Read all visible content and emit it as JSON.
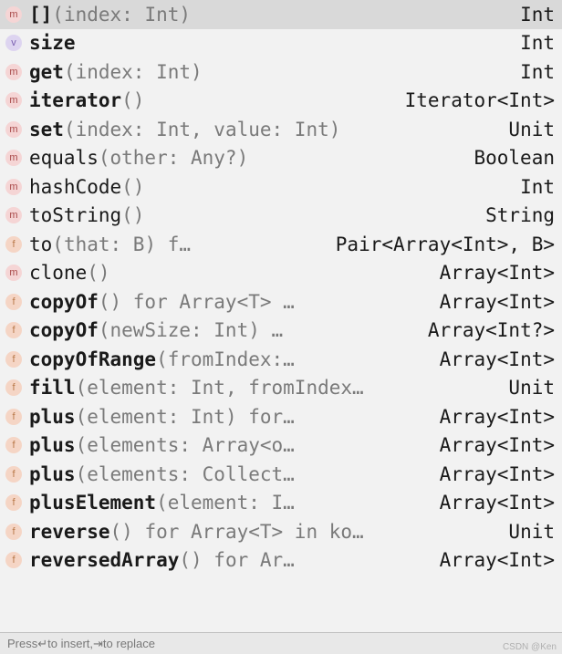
{
  "items": [
    {
      "kind": "m",
      "name": "[]",
      "bold": true,
      "params": "(index: Int)",
      "type": "Int",
      "selected": true
    },
    {
      "kind": "v",
      "name": "size",
      "bold": true,
      "params": "",
      "type": "Int"
    },
    {
      "kind": "m",
      "name": "get",
      "bold": true,
      "params": "(index: Int)",
      "type": "Int"
    },
    {
      "kind": "m",
      "name": "iterator",
      "bold": true,
      "params": "()",
      "type": "Iterator<Int>"
    },
    {
      "kind": "m",
      "name": "set",
      "bold": true,
      "params": "(index: Int, value: Int)",
      "type": "Unit"
    },
    {
      "kind": "m",
      "name": "equals",
      "bold": false,
      "params": "(other: Any?)",
      "type": "Boolean"
    },
    {
      "kind": "m",
      "name": "hashCode",
      "bold": false,
      "params": "()",
      "type": "Int"
    },
    {
      "kind": "m",
      "name": "toString",
      "bold": false,
      "params": "()",
      "type": "String"
    },
    {
      "kind": "f",
      "name": "to",
      "bold": false,
      "params": "(that: B) f…",
      "type": "Pair<Array<Int>, B>"
    },
    {
      "kind": "m",
      "name": "clone",
      "bold": false,
      "params": "()",
      "type": "Array<Int>"
    },
    {
      "kind": "f",
      "name": "copyOf",
      "bold": true,
      "params": "() for Array<T> …",
      "type": "Array<Int>"
    },
    {
      "kind": "f",
      "name": "copyOf",
      "bold": true,
      "params": "(newSize: Int) …",
      "type": "Array<Int?>"
    },
    {
      "kind": "f",
      "name": "copyOfRange",
      "bold": true,
      "params": "(fromIndex:…",
      "type": "Array<Int>"
    },
    {
      "kind": "f",
      "name": "fill",
      "bold": true,
      "params": "(element: Int, fromIndex…",
      "type": "Unit"
    },
    {
      "kind": "f",
      "name": "plus",
      "bold": true,
      "params": "(element: Int) for…",
      "type": "Array<Int>"
    },
    {
      "kind": "f",
      "name": "plus",
      "bold": true,
      "params": "(elements: Array<o…",
      "type": "Array<Int>"
    },
    {
      "kind": "f",
      "name": "plus",
      "bold": true,
      "params": "(elements: Collect…",
      "type": "Array<Int>"
    },
    {
      "kind": "f",
      "name": "plusElement",
      "bold": true,
      "params": "(element: I…",
      "type": "Array<Int>"
    },
    {
      "kind": "f",
      "name": "reverse",
      "bold": true,
      "params": "() for Array<T> in ko…",
      "type": "Unit"
    },
    {
      "kind": "f",
      "name": "reversedArray",
      "bold": true,
      "params": "() for Ar…",
      "type": "Array<Int>"
    }
  ],
  "footer": {
    "press": "Press ",
    "enter": "↵",
    "toInsert": " to insert, ",
    "tab": "⇥",
    "toReplace": " to replace"
  },
  "watermark": "CSDN @Ken"
}
